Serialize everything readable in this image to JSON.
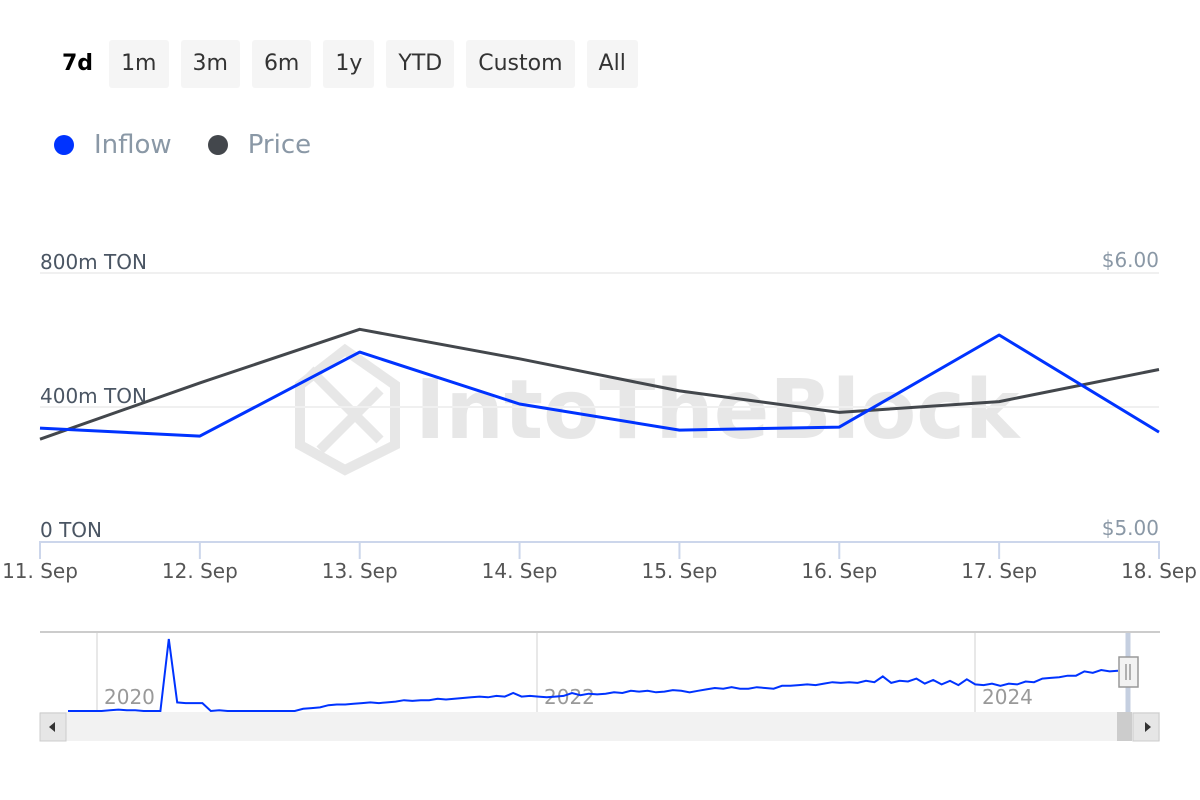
{
  "range_selector": {
    "buttons": [
      {
        "label": "7d",
        "active": true
      },
      {
        "label": "1m",
        "active": false
      },
      {
        "label": "3m",
        "active": false
      },
      {
        "label": "6m",
        "active": false
      },
      {
        "label": "1y",
        "active": false
      },
      {
        "label": "YTD",
        "active": false
      },
      {
        "label": "Custom",
        "active": false
      },
      {
        "label": "All",
        "active": false
      }
    ]
  },
  "legend": {
    "items": [
      {
        "label": "Inflow",
        "color": "#0033ff"
      },
      {
        "label": "Price",
        "color": "#43474c"
      }
    ]
  },
  "watermark": "IntoTheBlock",
  "chart_data": {
    "type": "line",
    "title": "",
    "categories": [
      "11. Sep",
      "12. Sep",
      "13. Sep",
      "14. Sep",
      "15. Sep",
      "16. Sep",
      "17. Sep",
      "18. Sep"
    ],
    "series": [
      {
        "name": "Inflow",
        "axis": "left",
        "color": "#0033ff",
        "unit": "m TON",
        "values": [
          337,
          313,
          564,
          409,
          331,
          340,
          615,
          325
        ]
      },
      {
        "name": "Price",
        "axis": "right",
        "color": "#43474c",
        "unit": "USD",
        "values": [
          5.38,
          5.59,
          5.79,
          5.68,
          5.56,
          5.48,
          5.52,
          5.64
        ]
      }
    ],
    "y_left": {
      "ticks": [
        "0 TON",
        "400m TON",
        "800m TON"
      ],
      "tick_values": [
        0,
        400,
        800
      ],
      "range": [
        0,
        800
      ]
    },
    "y_right": {
      "ticks": [
        "$5.00",
        "$6.00"
      ],
      "tick_values": [
        5.0,
        6.0
      ],
      "range": [
        5.0,
        6.0
      ]
    },
    "grid": true,
    "legend_position": "top-left",
    "navigator": {
      "year_labels": [
        "2020",
        "2022",
        "2024"
      ],
      "series_name": "Inflow",
      "relative_values": [
        0.0,
        0.0,
        0.0,
        0.0,
        0.0,
        0.01,
        0.02,
        0.01,
        0.01,
        0.0,
        0.0,
        0.0,
        1.0,
        0.12,
        0.11,
        0.11,
        0.11,
        0.0,
        0.01,
        0.0,
        0.0,
        0.0,
        0.0,
        0.0,
        0.0,
        0.0,
        0.0,
        0.0,
        0.03,
        0.04,
        0.05,
        0.08,
        0.09,
        0.09,
        0.1,
        0.11,
        0.12,
        0.11,
        0.12,
        0.13,
        0.15,
        0.14,
        0.15,
        0.15,
        0.17,
        0.16,
        0.17,
        0.18,
        0.19,
        0.2,
        0.19,
        0.21,
        0.2,
        0.25,
        0.2,
        0.21,
        0.2,
        0.19,
        0.2,
        0.21,
        0.25,
        0.22,
        0.24,
        0.23,
        0.24,
        0.26,
        0.25,
        0.28,
        0.27,
        0.28,
        0.26,
        0.27,
        0.29,
        0.28,
        0.26,
        0.28,
        0.3,
        0.32,
        0.31,
        0.33,
        0.31,
        0.31,
        0.33,
        0.32,
        0.31,
        0.35,
        0.35,
        0.36,
        0.37,
        0.36,
        0.38,
        0.4,
        0.39,
        0.4,
        0.39,
        0.42,
        0.4,
        0.48,
        0.39,
        0.42,
        0.41,
        0.45,
        0.38,
        0.43,
        0.37,
        0.42,
        0.36,
        0.44,
        0.37,
        0.36,
        0.38,
        0.35,
        0.38,
        0.37,
        0.41,
        0.4,
        0.45,
        0.46,
        0.47,
        0.49,
        0.49,
        0.55,
        0.53,
        0.57,
        0.55,
        0.56
      ]
    }
  }
}
